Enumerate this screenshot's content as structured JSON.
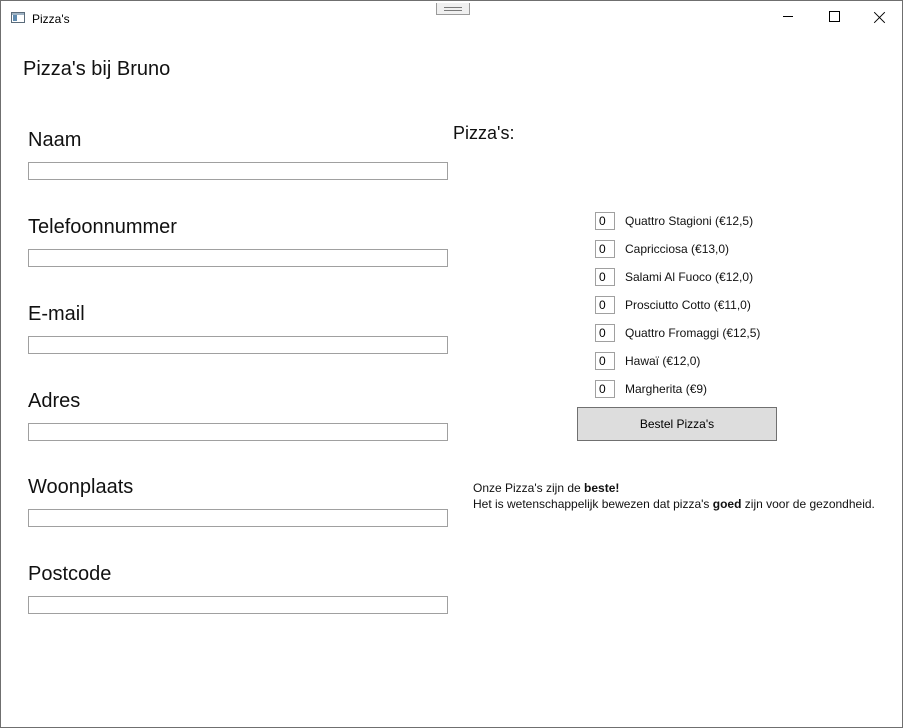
{
  "window": {
    "title": "Pizza's",
    "app_icon": "window-app-icon",
    "controls": {
      "minimize": "minimize-icon",
      "maximize": "maximize-icon",
      "close": "close-icon"
    }
  },
  "heading": "Pizza's bij Bruno",
  "form": {
    "fields": [
      {
        "label": "Naam",
        "value": ""
      },
      {
        "label": "Telefoonnummer",
        "value": ""
      },
      {
        "label": "E-mail",
        "value": ""
      },
      {
        "label": "Adres",
        "value": ""
      },
      {
        "label": "Woonplaats",
        "value": ""
      },
      {
        "label": "Postcode",
        "value": ""
      }
    ]
  },
  "pizzas": {
    "heading": "Pizza's:",
    "items": [
      {
        "quantity": "0",
        "name": "Quattro Stagioni (€12,5)"
      },
      {
        "quantity": "0",
        "name": "Capricciosa (€13,0)"
      },
      {
        "quantity": "0",
        "name": "Salami Al Fuoco (€12,0)"
      },
      {
        "quantity": "0",
        "name": "Prosciutto Cotto (€11,0)"
      },
      {
        "quantity": "0",
        "name": "Quattro Fromaggi (€12,5)"
      },
      {
        "quantity": "0",
        "name": "Hawaï (€12,0)"
      },
      {
        "quantity": "0",
        "name": "Margherita (€9)"
      }
    ],
    "order_button": "Bestel Pizza's"
  },
  "info": {
    "line1_prefix": "Onze Pizza's zijn de ",
    "line1_bold": "beste!",
    "line2_prefix": "Het is wetenschappelijk bewezen dat pizza's ",
    "line2_bold": "goed",
    "line2_suffix": " zijn voor de gezondheid."
  }
}
